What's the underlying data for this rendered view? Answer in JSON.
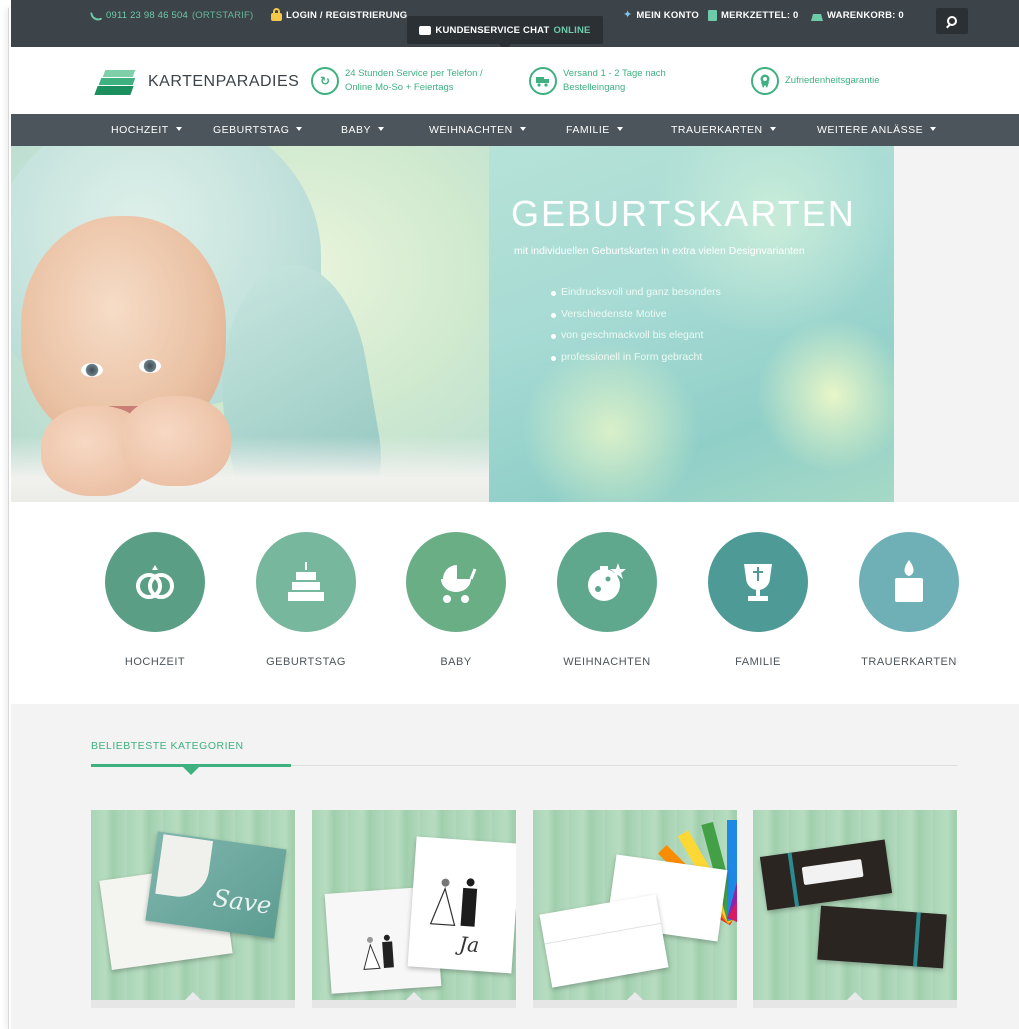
{
  "topbar": {
    "phone": "0911 23 98 46 504",
    "phone_tarif": "(ORTSTARIF)",
    "login": "LOGIN / REGISTRIERUNG",
    "chat_label": "KUNDENSERVICE CHAT",
    "chat_status": "ONLINE",
    "account": "MEIN KONTO",
    "wishlist": "MERKZETTEL: 0",
    "cart": "WARENKORB: 0"
  },
  "header": {
    "logo_text": "KARTENPARADIES",
    "usps": [
      {
        "line1": "24 Stunden Service per Telefon /",
        "line2": "Online Mo-So + Feiertags"
      },
      {
        "line1": "Versand 1 - 2 Tage nach",
        "line2": "Bestelleingang"
      },
      {
        "line1": "Zufriedenheitsgarantie",
        "line2": ""
      }
    ]
  },
  "nav": {
    "items": [
      {
        "label": "HOCHZEIT"
      },
      {
        "label": "GEBURTSTAG"
      },
      {
        "label": "BABY"
      },
      {
        "label": "WEIHNACHTEN"
      },
      {
        "label": "FAMILIE"
      },
      {
        "label": "TRAUERKARTEN"
      },
      {
        "label": "WEITERE ANLÄSSE"
      }
    ]
  },
  "hero": {
    "title": "GEBURTSKARTEN",
    "subtitle": "mit individuellen Geburtskarten in extra vielen Designvarianten",
    "bullets": [
      "Eindrucksvoll und ganz besonders",
      "Verschiedenste Motive",
      "von geschmackvoll bis elegant",
      "professionell in Form gebracht"
    ]
  },
  "categories": [
    {
      "label": "HOCHZEIT",
      "color": "#5a9e86",
      "icon": "rings-icon"
    },
    {
      "label": "GEBURTSTAG",
      "color": "#76b79d",
      "icon": "cake-icon"
    },
    {
      "label": "BABY",
      "color": "#6aae86",
      "icon": "stroller-icon"
    },
    {
      "label": "WEIHNACHTEN",
      "color": "#5fa88e",
      "icon": "ornament-icon"
    },
    {
      "label": "FAMILIE",
      "color": "#4e9a96",
      "icon": "chalice-icon"
    },
    {
      "label": "TRAUERKARTEN",
      "color": "#6eb0b6",
      "icon": "candle-icon"
    }
  ],
  "popular": {
    "tab_label": "BELIEBTESTE KATEGORIEN"
  },
  "card_text": {
    "save": "Save",
    "ja": "Ja"
  },
  "colors": {
    "accent": "#3fb080",
    "topbar_bg": "#3c4349",
    "nav_bg": "#4c555b"
  }
}
